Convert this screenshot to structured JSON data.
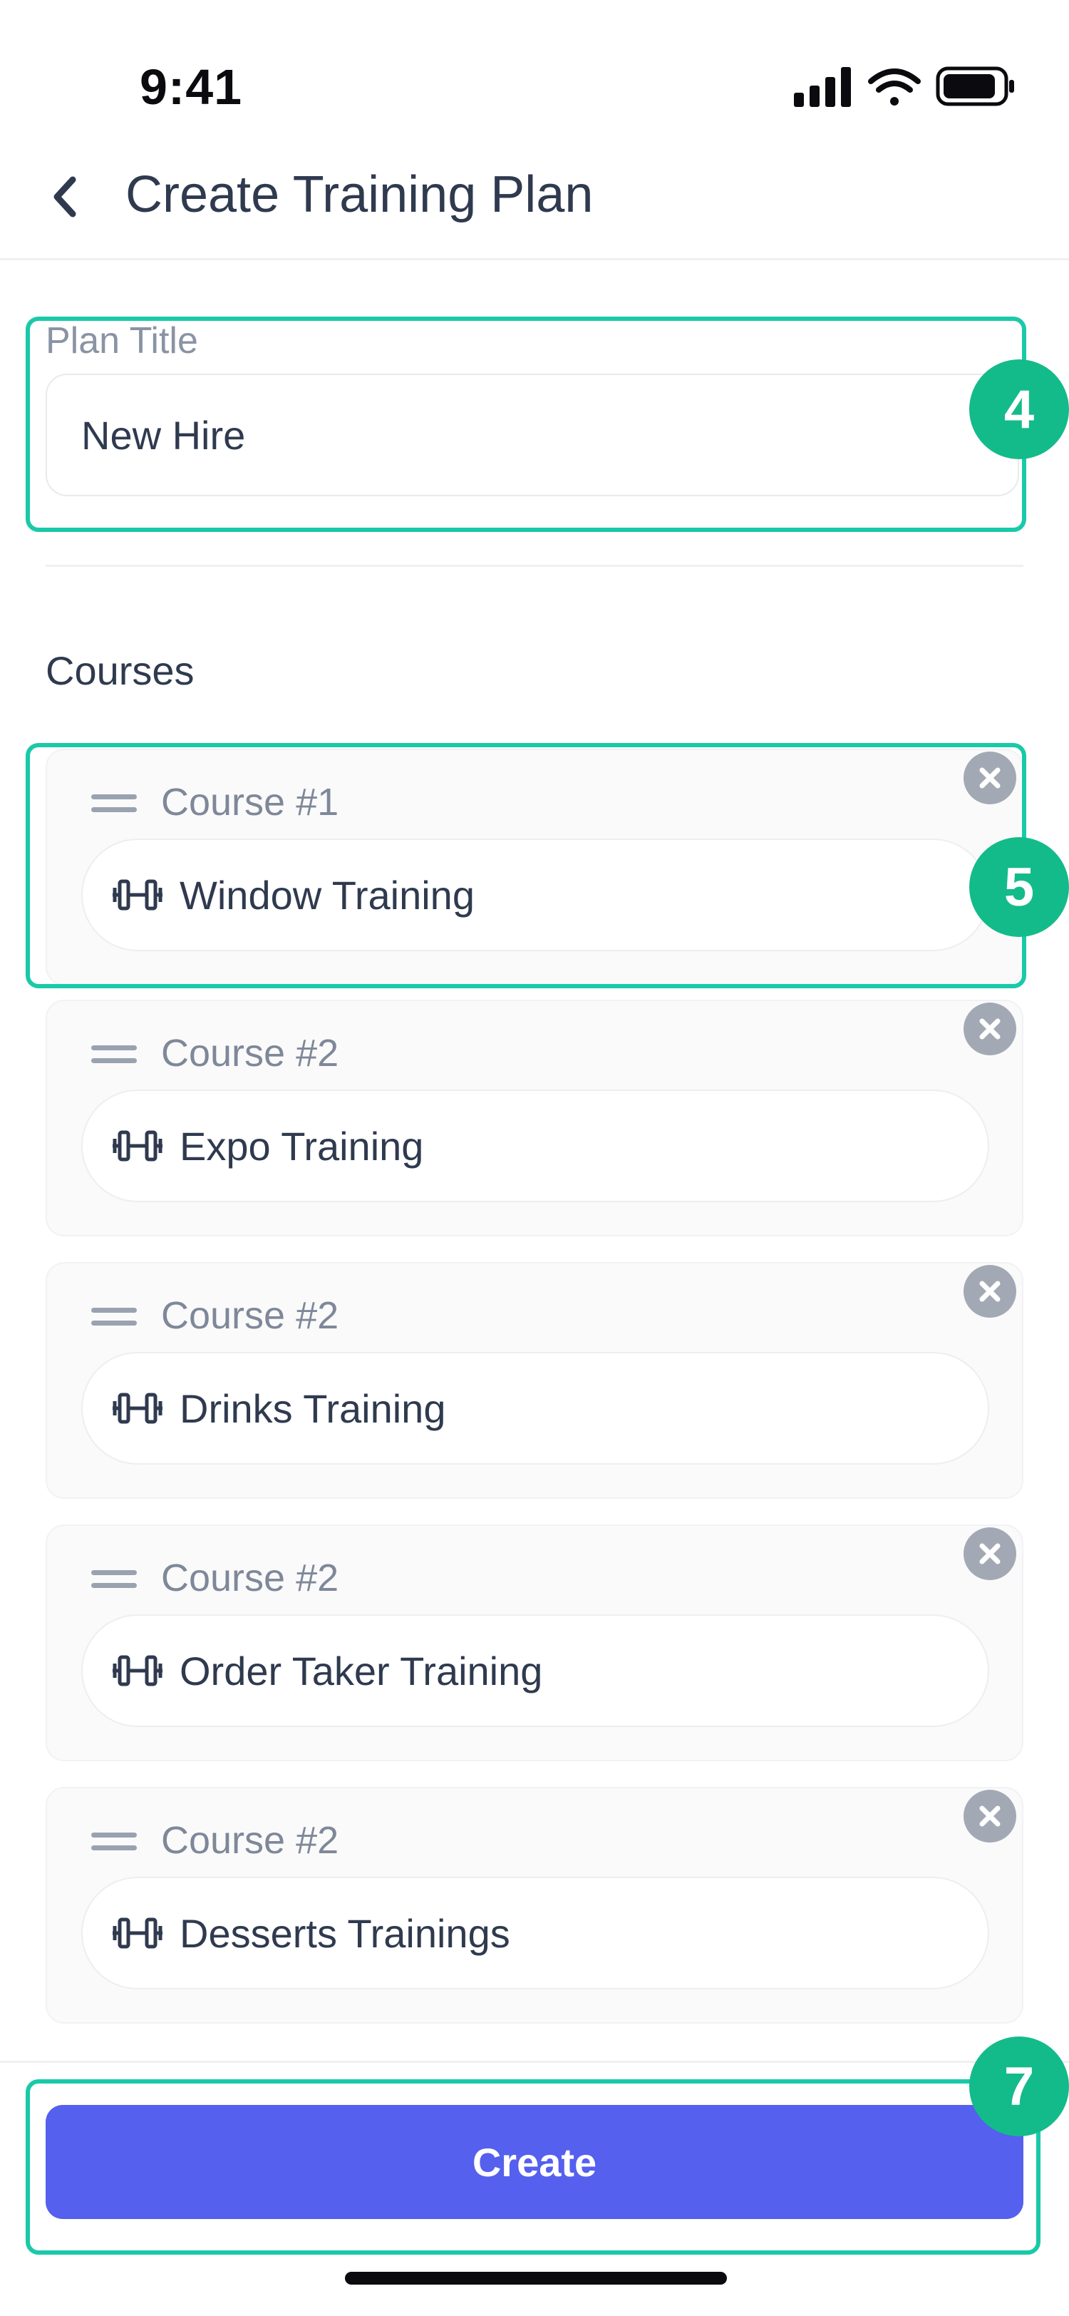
{
  "status_bar": {
    "time": "9:41"
  },
  "header": {
    "title": "Create Training Plan",
    "back_icon": "chevron-left-icon"
  },
  "plan_title": {
    "label": "Plan Title",
    "value": "New Hire"
  },
  "courses_section": {
    "label": "Courses"
  },
  "courses": [
    {
      "label": "Course #1",
      "name": "Window Training"
    },
    {
      "label": "Course #2",
      "name": "Expo Training"
    },
    {
      "label": "Course #2",
      "name": "Drinks Training"
    },
    {
      "label": "Course #2",
      "name": "Order Taker Training"
    },
    {
      "label": "Course #2",
      "name": "Desserts Trainings"
    }
  ],
  "actions": {
    "create_label": "Create"
  },
  "annotations": {
    "plan_title_step": "4",
    "course_step": "5",
    "create_step": "7"
  },
  "colors": {
    "accent": "#5560ee",
    "highlight": "#1ac9a8",
    "badge": "#14bb8a",
    "text": "#2f3a4f",
    "muted": "#8a93a3"
  }
}
